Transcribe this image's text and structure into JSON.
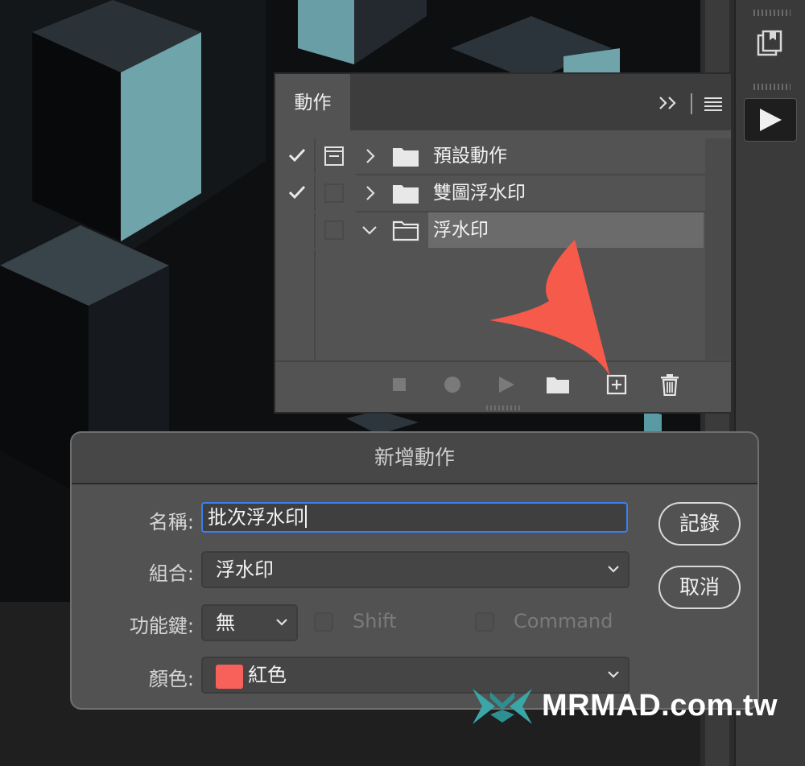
{
  "actions_panel": {
    "tab_label": "動作",
    "rows": [
      {
        "label": "預設動作",
        "checked": true,
        "dialog_toggle": true,
        "expanded": false,
        "selected": false
      },
      {
        "label": "雙圖浮水印",
        "checked": true,
        "dialog_toggle": false,
        "expanded": false,
        "selected": false
      },
      {
        "label": "浮水印",
        "checked": false,
        "dialog_toggle": false,
        "expanded": true,
        "selected": true
      }
    ],
    "footer_buttons": [
      "stop-icon",
      "record-icon",
      "play-icon",
      "folder-icon",
      "new-action-icon",
      "trash-icon"
    ]
  },
  "dialog": {
    "title": "新增動作",
    "name_label": "名稱:",
    "name_value": "批次浮水印",
    "set_label": "組合:",
    "set_value": "浮水印",
    "key_label": "功能鍵:",
    "key_value": "無",
    "shift_label": "Shift",
    "command_label": "Command",
    "color_label": "顏色:",
    "color_value": "紅色",
    "color_swatch": "#f8615a",
    "record_button": "記錄",
    "cancel_button": "取消"
  },
  "watermark": {
    "text": "MRMAD.com.tw"
  },
  "colors": {
    "accent_arrow": "#f65a4b",
    "focus_ring": "#3b7ff0",
    "teal": "#5aa0a8"
  }
}
